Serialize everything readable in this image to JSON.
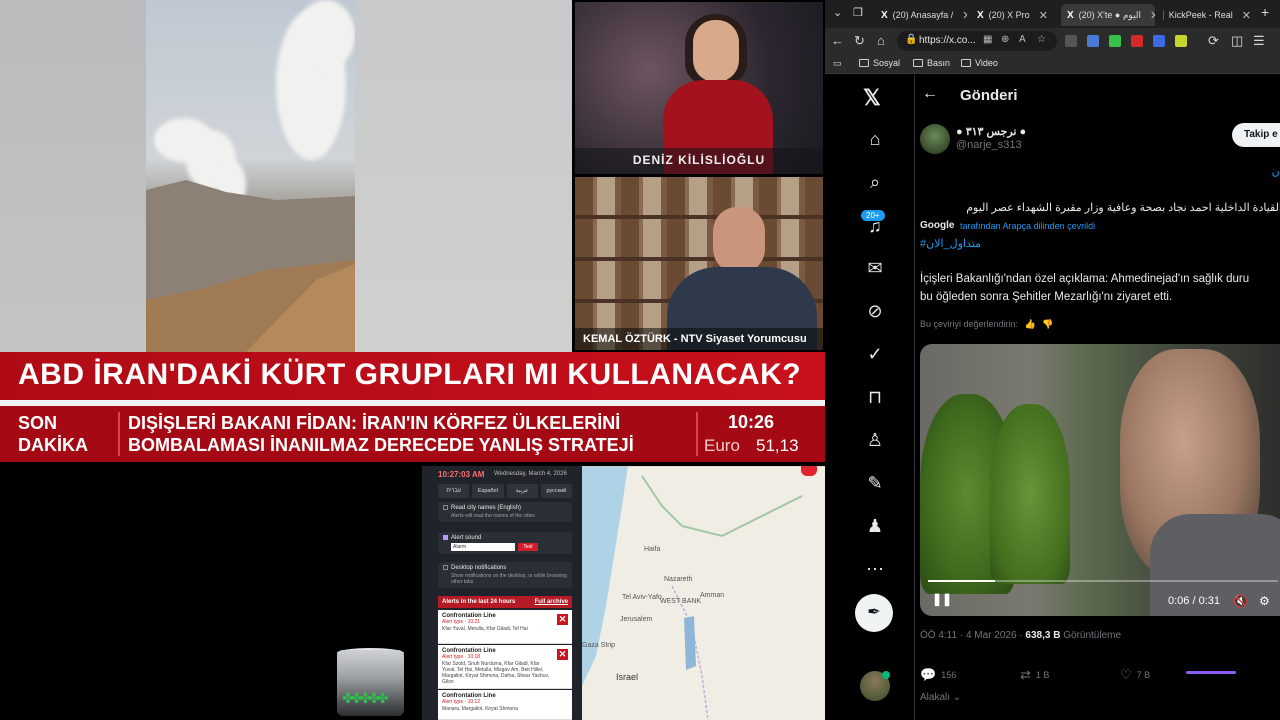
{
  "broadcast": {
    "anchor_name": "DENİZ KİLİSLİOĞLU",
    "guest_name": "KEMAL ÖZTÜRK - NTV Siyaset Yorumcusu",
    "headline": "ABD İRAN'DAKİ KÜRT GRUPLARI MI KULLANACAK?",
    "ticker_tag_line1": "SON",
    "ticker_tag_line2": "DAKİKA",
    "ticker_line1": "DIŞİŞLERİ BAKANI FİDAN: İRAN'IN KÖRFEZ ÜLKELERİNİ",
    "ticker_line2": "BOMBALAMASI İNANILMAZ DERECEDE YANLIŞ STRATEJİ",
    "clock": "10:26",
    "currency_label": "Euro",
    "currency_value": "51,13"
  },
  "alerts_panel": {
    "time": "10:27:03 AM",
    "date": "Wednesday, March 4, 2026",
    "languages": [
      "עברית",
      "Español",
      "عربية",
      "русский"
    ],
    "options": [
      {
        "title": "Read city names (English)",
        "desc": "Alerts will read the names of the cities"
      },
      {
        "title": "Alert sound",
        "select": "Alarm",
        "test": "Test"
      },
      {
        "title": "Desktop notifications",
        "desc": "Show notifications on the desktop, or while browsing other tabs"
      }
    ],
    "archive_title": "Alerts in the last 24 hours",
    "archive_link": "Full archive",
    "alerts": [
      {
        "title": "Confrontation Line",
        "time": "Alert type · 10:21",
        "cities": "Kfar Yuval, Metulla, Kfar Giladi, Tel Hai"
      },
      {
        "title": "Confrontation Line",
        "time": "Alert type · 10:18",
        "cities": "Kfar Szold, Snuh Nurduma, Kfar Giladi, Kfar Yuval, Tel Hai, Metulla, Misgav Am, Beit Hillel, Margaliot, Kiryat Shmona, Dafna, Shear Yashuv, Gilon"
      },
      {
        "title": "Confrontation Line",
        "time": "Alert type · 10:12",
        "cities": "Manara, Margaliot, Kiryat Shmona"
      }
    ]
  },
  "map": {
    "labels": [
      "Haifa",
      "Nazareth",
      "Tel Aviv-Yafo",
      "Jerusalem",
      "WEST BANK",
      "Amman",
      "Israel",
      "Gaza Strip"
    ]
  },
  "browser": {
    "tabs": [
      {
        "label": "(20) Anasayfa / ",
        "icon": "X"
      },
      {
        "label": "(20) X Pro",
        "icon": "X"
      },
      {
        "label": "(20) X'te ● اليوم",
        "icon": "X"
      },
      {
        "label": "KickPeek - Real",
        "icon": "K"
      }
    ],
    "url": "https://x.co...",
    "bookmarks": [
      "Sosyal",
      "Basın",
      "Video"
    ]
  },
  "x": {
    "page_title": "Gönderi",
    "author_name": "● نرجس ٣١٣ ●",
    "author_handle": "@narje_s313",
    "follow_label": "Takip e",
    "top_link": "لان",
    "arabic_text": "القيادة الداخلية احمد نجاد بصحة وعافية وزار مقبرة الشهداء عصر اليوم",
    "google_label": "Google",
    "google_translated": "tarafından Arapça dilinden çevrildi",
    "hashtag": "#متداول_الان",
    "translation_line1": "İçişleri Bakanlığı'ndan özel açıklama: Ahmedinejad'ın sağlık duru",
    "translation_line2": "bu öğleden sonra Şehitler Mezarlığı'nı ziyaret etti.",
    "rate_label": "Bu çeviriyi değerlendirin:",
    "video_time": "0:06 / 0:31",
    "video_progress": 0.19,
    "meta_time": "ÖÖ 4:11 · 4 Mar 2026 · ",
    "meta_views": "638,3 B",
    "meta_views_label": " Görüntüleme",
    "replies": "156",
    "reposts": "1 B",
    "likes": "7 B",
    "related": "Alakalı ⌄",
    "notif_badge": "20+"
  },
  "colors": {
    "headline_red": "#c8101c",
    "ticker_red": "#a50a14",
    "x_blue": "#1d9bf0"
  }
}
